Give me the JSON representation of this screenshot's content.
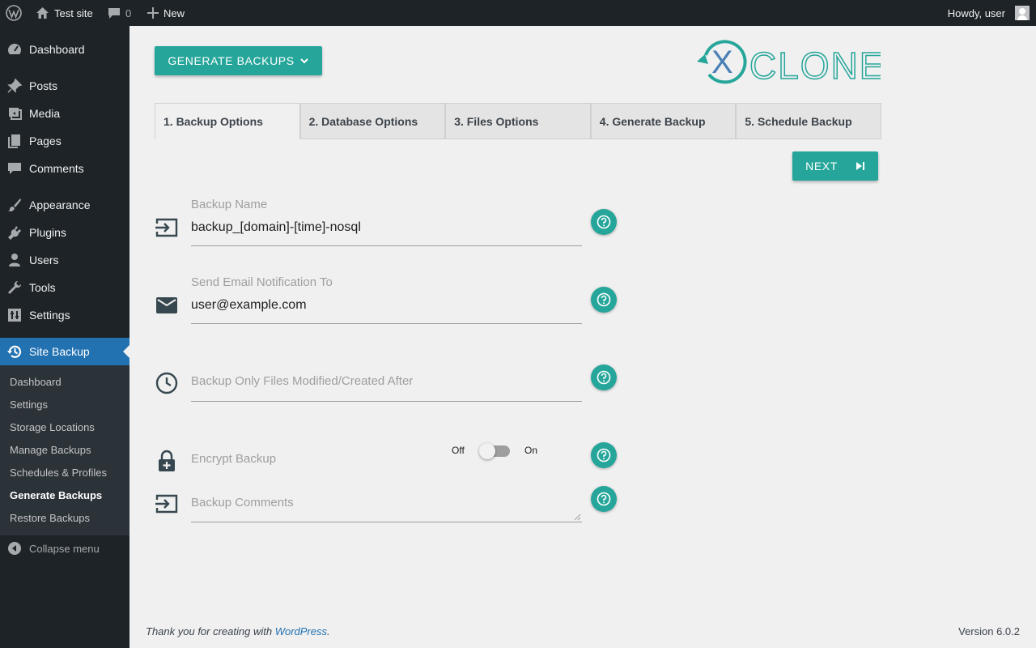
{
  "adminbar": {
    "site_name": "Test site",
    "comments_count": "0",
    "new_label": "New",
    "greeting": "Howdy, user"
  },
  "sidebar": {
    "items": [
      {
        "label": "Dashboard",
        "icon": "dashboard-icon"
      },
      {
        "label": "Posts",
        "icon": "pin-icon"
      },
      {
        "label": "Media",
        "icon": "media-icon"
      },
      {
        "label": "Pages",
        "icon": "pages-icon"
      },
      {
        "label": "Comments",
        "icon": "comment-icon"
      },
      {
        "label": "Appearance",
        "icon": "brush-icon"
      },
      {
        "label": "Plugins",
        "icon": "plug-icon"
      },
      {
        "label": "Users",
        "icon": "user-icon"
      },
      {
        "label": "Tools",
        "icon": "wrench-icon"
      },
      {
        "label": "Settings",
        "icon": "settings-icon"
      },
      {
        "label": "Site Backup",
        "icon": "history-icon"
      }
    ],
    "submenu": [
      "Dashboard",
      "Settings",
      "Storage Locations",
      "Manage Backups",
      "Schedules & Profiles",
      "Generate Backups",
      "Restore Backups"
    ],
    "collapse_label": "Collapse menu"
  },
  "main": {
    "generate_button": "GENERATE BACKUPS",
    "logo_text": "CLONER",
    "logo_letter": "X",
    "tabs": [
      "1. Backup Options",
      "2. Database Options",
      "3. Files Options",
      "4. Generate Backup",
      "5. Schedule Backup"
    ],
    "next_button": "NEXT",
    "fields": {
      "backup_name": {
        "label": "Backup Name",
        "value": "backup_[domain]-[time]-nosql"
      },
      "email": {
        "label": "Send Email Notification To",
        "value": "user@example.com"
      },
      "modified_after": {
        "placeholder": "Backup Only Files Modified/Created After"
      },
      "encrypt": {
        "label": "Encrypt Backup",
        "off_label": "Off",
        "on_label": "On",
        "enabled": false
      },
      "comments": {
        "placeholder": "Backup Comments"
      }
    }
  },
  "footer": {
    "thanks_prefix": "Thank you for creating with ",
    "wordpress_link": "WordPress",
    "thanks_suffix": ".",
    "version": "Version 6.0.2"
  },
  "colors": {
    "accent": "#26a69a",
    "admin_bg": "#1d2327",
    "current_menu": "#2271b1"
  }
}
